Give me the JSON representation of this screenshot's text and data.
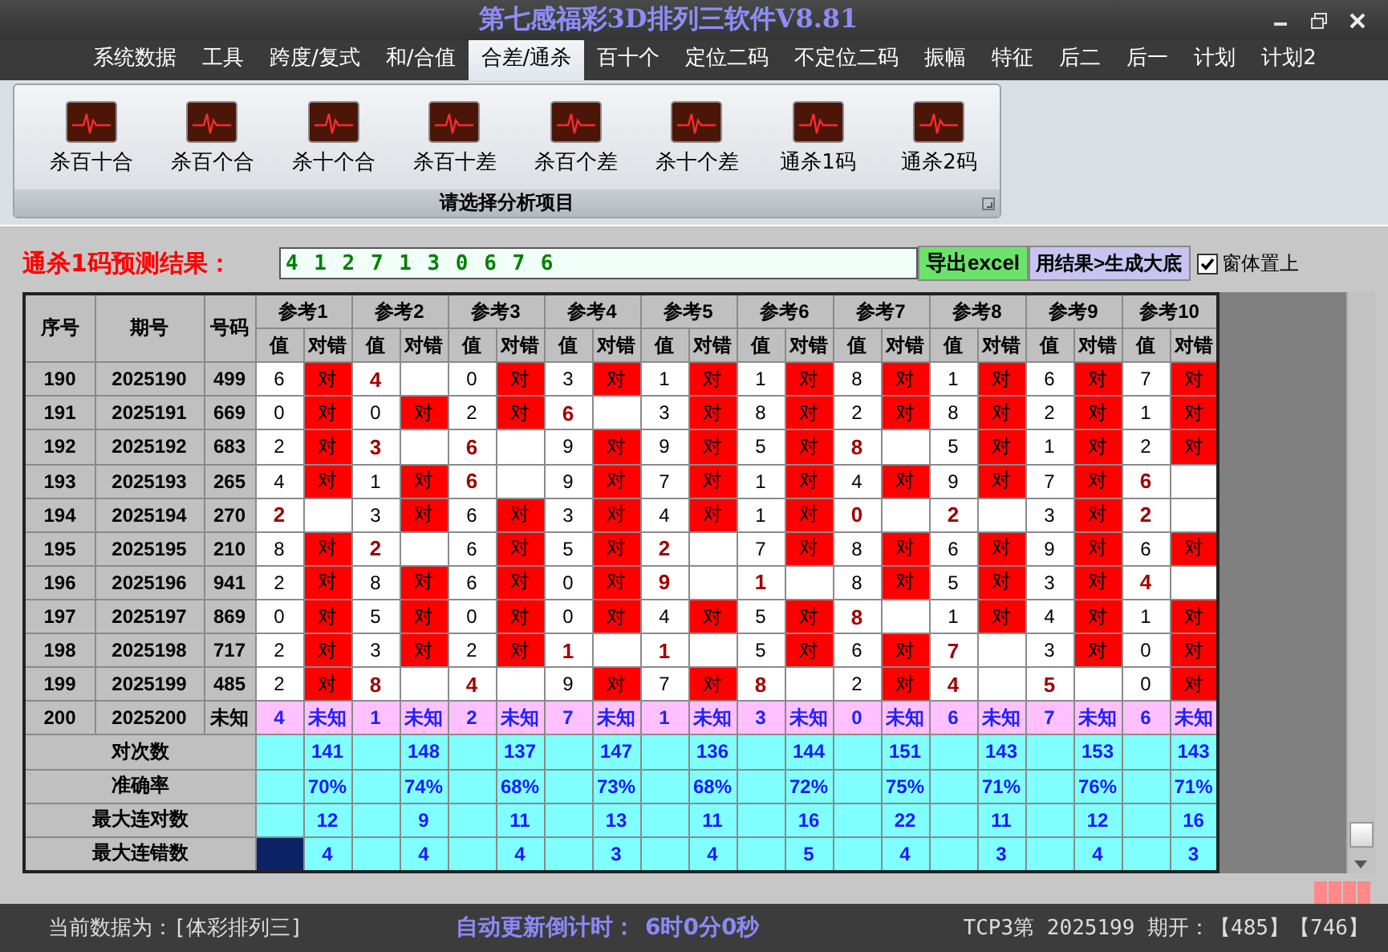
{
  "window": {
    "title": "第七感福彩3D排列三软件V8.81"
  },
  "menu": [
    {
      "label": "系统数据",
      "selected": false
    },
    {
      "label": "工具",
      "selected": false
    },
    {
      "label": "跨度/复式",
      "selected": false
    },
    {
      "label": "和/合值",
      "selected": false
    },
    {
      "label": "合差/通杀",
      "selected": true
    },
    {
      "label": "百十个",
      "selected": false
    },
    {
      "label": "定位二码",
      "selected": false
    },
    {
      "label": "不定位二码",
      "selected": false
    },
    {
      "label": "振幅",
      "selected": false
    },
    {
      "label": "特征",
      "selected": false
    },
    {
      "label": "后二",
      "selected": false
    },
    {
      "label": "后一",
      "selected": false
    },
    {
      "label": "计划",
      "selected": false
    },
    {
      "label": "计划2",
      "selected": false
    }
  ],
  "ribbon": {
    "items": [
      "杀百十合",
      "杀百个合",
      "杀十个合",
      "杀百十差",
      "杀百个差",
      "杀十个差",
      "通杀1码",
      "通杀2码"
    ],
    "group_label": "请选择分析项目"
  },
  "prediction": {
    "label": "通杀1码预测结果：",
    "value": "4 1 2 7 1 3 0 6 7 6",
    "buttons": [
      {
        "label": "导出excel",
        "kind": "export"
      },
      {
        "label": "用结果>生成大底",
        "kind": "generate"
      }
    ],
    "topmost": {
      "label": "窗体置上",
      "checked": true
    }
  },
  "table": {
    "columns": [
      "序号",
      "期号",
      "号码"
    ],
    "groups": [
      {
        "label": "参考1",
        "sub": [
          "值",
          "对错"
        ]
      },
      {
        "label": "参考2",
        "sub": [
          "值",
          "对错"
        ]
      },
      {
        "label": "参考3",
        "sub": [
          "值",
          "对错"
        ]
      },
      {
        "label": "参考4",
        "sub": [
          "值",
          "对错"
        ]
      },
      {
        "label": "参考5",
        "sub": [
          "值",
          "对错"
        ]
      },
      {
        "label": "参考6",
        "sub": [
          "值",
          "对错"
        ]
      },
      {
        "label": "参考7",
        "sub": [
          "值",
          "对错"
        ]
      },
      {
        "label": "参考8",
        "sub": [
          "值",
          "对错"
        ]
      },
      {
        "label": "参考9",
        "sub": [
          "值",
          "对错"
        ]
      },
      {
        "label": "参考10",
        "sub": [
          "值",
          "对错"
        ]
      }
    ],
    "rows": [
      {
        "kind": "history",
        "seq": "190",
        "issue": "2025190",
        "number": "499",
        "refs": [
          {
            "value": "6",
            "hit": true,
            "result": "对"
          },
          {
            "value": "4",
            "hit": false
          },
          {
            "value": "0",
            "hit": true,
            "result": "对"
          },
          {
            "value": "3",
            "hit": true,
            "result": "对"
          },
          {
            "value": "1",
            "hit": true,
            "result": "对"
          },
          {
            "value": "1",
            "hit": true,
            "result": "对"
          },
          {
            "value": "8",
            "hit": true,
            "result": "对"
          },
          {
            "value": "1",
            "hit": true,
            "result": "对"
          },
          {
            "value": "6",
            "hit": true,
            "result": "对"
          },
          {
            "value": "7",
            "hit": true,
            "result": "对"
          }
        ]
      },
      {
        "kind": "history",
        "seq": "191",
        "issue": "2025191",
        "number": "669",
        "refs": [
          {
            "value": "0",
            "hit": true,
            "result": "对"
          },
          {
            "value": "0",
            "hit": true,
            "result": "对"
          },
          {
            "value": "2",
            "hit": true,
            "result": "对"
          },
          {
            "value": "6",
            "hit": false
          },
          {
            "value": "3",
            "hit": true,
            "result": "对"
          },
          {
            "value": "8",
            "hit": true,
            "result": "对"
          },
          {
            "value": "2",
            "hit": true,
            "result": "对"
          },
          {
            "value": "8",
            "hit": true,
            "result": "对"
          },
          {
            "value": "2",
            "hit": true,
            "result": "对"
          },
          {
            "value": "1",
            "hit": true,
            "result": "对"
          }
        ]
      },
      {
        "kind": "history",
        "seq": "192",
        "issue": "2025192",
        "number": "683",
        "refs": [
          {
            "value": "2",
            "hit": true,
            "result": "对"
          },
          {
            "value": "3",
            "hit": false
          },
          {
            "value": "6",
            "hit": false
          },
          {
            "value": "9",
            "hit": true,
            "result": "对"
          },
          {
            "value": "9",
            "hit": true,
            "result": "对"
          },
          {
            "value": "5",
            "hit": true,
            "result": "对"
          },
          {
            "value": "8",
            "hit": false
          },
          {
            "value": "5",
            "hit": true,
            "result": "对"
          },
          {
            "value": "1",
            "hit": true,
            "result": "对"
          },
          {
            "value": "2",
            "hit": true,
            "result": "对"
          }
        ]
      },
      {
        "kind": "history",
        "seq": "193",
        "issue": "2025193",
        "number": "265",
        "refs": [
          {
            "value": "4",
            "hit": true,
            "result": "对"
          },
          {
            "value": "1",
            "hit": true,
            "result": "对"
          },
          {
            "value": "6",
            "hit": false
          },
          {
            "value": "9",
            "hit": true,
            "result": "对"
          },
          {
            "value": "7",
            "hit": true,
            "result": "对"
          },
          {
            "value": "1",
            "hit": true,
            "result": "对"
          },
          {
            "value": "4",
            "hit": true,
            "result": "对"
          },
          {
            "value": "9",
            "hit": true,
            "result": "对"
          },
          {
            "value": "7",
            "hit": true,
            "result": "对"
          },
          {
            "value": "6",
            "hit": false
          }
        ]
      },
      {
        "kind": "history",
        "seq": "194",
        "issue": "2025194",
        "number": "270",
        "refs": [
          {
            "value": "2",
            "hit": false
          },
          {
            "value": "3",
            "hit": true,
            "result": "对"
          },
          {
            "value": "6",
            "hit": true,
            "result": "对"
          },
          {
            "value": "3",
            "hit": true,
            "result": "对"
          },
          {
            "value": "4",
            "hit": true,
            "result": "对"
          },
          {
            "value": "1",
            "hit": true,
            "result": "对"
          },
          {
            "value": "0",
            "hit": false
          },
          {
            "value": "2",
            "hit": false
          },
          {
            "value": "3",
            "hit": true,
            "result": "对"
          },
          {
            "value": "2",
            "hit": false
          }
        ]
      },
      {
        "kind": "history",
        "seq": "195",
        "issue": "2025195",
        "number": "210",
        "refs": [
          {
            "value": "8",
            "hit": true,
            "result": "对"
          },
          {
            "value": "2",
            "hit": false
          },
          {
            "value": "6",
            "hit": true,
            "result": "对"
          },
          {
            "value": "5",
            "hit": true,
            "result": "对"
          },
          {
            "value": "2",
            "hit": false
          },
          {
            "value": "7",
            "hit": true,
            "result": "对"
          },
          {
            "value": "8",
            "hit": true,
            "result": "对"
          },
          {
            "value": "6",
            "hit": true,
            "result": "对"
          },
          {
            "value": "9",
            "hit": true,
            "result": "对"
          },
          {
            "value": "6",
            "hit": true,
            "result": "对"
          }
        ]
      },
      {
        "kind": "history",
        "seq": "196",
        "issue": "2025196",
        "number": "941",
        "refs": [
          {
            "value": "2",
            "hit": true,
            "result": "对"
          },
          {
            "value": "8",
            "hit": true,
            "result": "对"
          },
          {
            "value": "6",
            "hit": true,
            "result": "对"
          },
          {
            "value": "0",
            "hit": true,
            "result": "对"
          },
          {
            "value": "9",
            "hit": false
          },
          {
            "value": "1",
            "hit": false
          },
          {
            "value": "8",
            "hit": true,
            "result": "对"
          },
          {
            "value": "5",
            "hit": true,
            "result": "对"
          },
          {
            "value": "3",
            "hit": true,
            "result": "对"
          },
          {
            "value": "4",
            "hit": false
          }
        ]
      },
      {
        "kind": "history",
        "seq": "197",
        "issue": "2025197",
        "number": "869",
        "refs": [
          {
            "value": "0",
            "hit": true,
            "result": "对"
          },
          {
            "value": "5",
            "hit": true,
            "result": "对"
          },
          {
            "value": "0",
            "hit": true,
            "result": "对"
          },
          {
            "value": "0",
            "hit": true,
            "result": "对"
          },
          {
            "value": "4",
            "hit": true,
            "result": "对"
          },
          {
            "value": "5",
            "hit": true,
            "result": "对"
          },
          {
            "value": "8",
            "hit": false
          },
          {
            "value": "1",
            "hit": true,
            "result": "对"
          },
          {
            "value": "4",
            "hit": true,
            "result": "对"
          },
          {
            "value": "1",
            "hit": true,
            "result": "对"
          }
        ]
      },
      {
        "kind": "history",
        "seq": "198",
        "issue": "2025198",
        "number": "717",
        "refs": [
          {
            "value": "2",
            "hit": true,
            "result": "对"
          },
          {
            "value": "3",
            "hit": true,
            "result": "对"
          },
          {
            "value": "2",
            "hit": true,
            "result": "对"
          },
          {
            "value": "1",
            "hit": false
          },
          {
            "value": "1",
            "hit": false
          },
          {
            "value": "5",
            "hit": true,
            "result": "对"
          },
          {
            "value": "6",
            "hit": true,
            "result": "对"
          },
          {
            "value": "7",
            "hit": false
          },
          {
            "value": "3",
            "hit": true,
            "result": "对"
          },
          {
            "value": "0",
            "hit": true,
            "result": "对"
          }
        ]
      },
      {
        "kind": "history",
        "seq": "199",
        "issue": "2025199",
        "number": "485",
        "refs": [
          {
            "value": "2",
            "hit": true,
            "result": "对"
          },
          {
            "value": "8",
            "hit": false
          },
          {
            "value": "4",
            "hit": false
          },
          {
            "value": "9",
            "hit": true,
            "result": "对"
          },
          {
            "value": "7",
            "hit": true,
            "result": "对"
          },
          {
            "value": "8",
            "hit": false
          },
          {
            "value": "2",
            "hit": true,
            "result": "对"
          },
          {
            "value": "4",
            "hit": false
          },
          {
            "value": "5",
            "hit": false
          },
          {
            "value": "0",
            "hit": true,
            "result": "对"
          }
        ]
      },
      {
        "kind": "pending",
        "seq": "200",
        "issue": "2025200",
        "number": "未知",
        "refs": [
          {
            "value": "4",
            "result": "未知"
          },
          {
            "value": "1",
            "result": "未知"
          },
          {
            "value": "2",
            "result": "未知"
          },
          {
            "value": "7",
            "result": "未知"
          },
          {
            "value": "1",
            "result": "未知"
          },
          {
            "value": "3",
            "result": "未知"
          },
          {
            "value": "0",
            "result": "未知"
          },
          {
            "value": "6",
            "result": "未知"
          },
          {
            "value": "7",
            "result": "未知"
          },
          {
            "value": "6",
            "result": "未知"
          }
        ]
      }
    ],
    "stats": [
      {
        "label": "对次数",
        "cells": [
          {
            "value": "141",
            "selected": false
          },
          {
            "value": "148",
            "selected": false
          },
          {
            "value": "137",
            "selected": false
          },
          {
            "value": "147",
            "selected": false
          },
          {
            "value": "136",
            "selected": false
          },
          {
            "value": "144",
            "selected": false
          },
          {
            "value": "151",
            "selected": false
          },
          {
            "value": "143",
            "selected": false
          },
          {
            "value": "153",
            "selected": false
          },
          {
            "value": "143",
            "selected": false
          }
        ]
      },
      {
        "label": "准确率",
        "cells": [
          {
            "value": "70%",
            "selected": false
          },
          {
            "value": "74%",
            "selected": false
          },
          {
            "value": "68%",
            "selected": false
          },
          {
            "value": "73%",
            "selected": false
          },
          {
            "value": "68%",
            "selected": false
          },
          {
            "value": "72%",
            "selected": false
          },
          {
            "value": "75%",
            "selected": false
          },
          {
            "value": "71%",
            "selected": false
          },
          {
            "value": "76%",
            "selected": false
          },
          {
            "value": "71%",
            "selected": false
          }
        ]
      },
      {
        "label": "最大连对数",
        "cells": [
          {
            "value": "12",
            "selected": false
          },
          {
            "value": "9",
            "selected": false
          },
          {
            "value": "11",
            "selected": false
          },
          {
            "value": "13",
            "selected": false
          },
          {
            "value": "11",
            "selected": false
          },
          {
            "value": "16",
            "selected": false
          },
          {
            "value": "22",
            "selected": false
          },
          {
            "value": "11",
            "selected": false
          },
          {
            "value": "12",
            "selected": false
          },
          {
            "value": "16",
            "selected": false
          }
        ]
      },
      {
        "label": "最大连错数",
        "cells": [
          {
            "value": "4",
            "selected": true
          },
          {
            "value": "4",
            "selected": false
          },
          {
            "value": "4",
            "selected": false
          },
          {
            "value": "3",
            "selected": false
          },
          {
            "value": "4",
            "selected": false
          },
          {
            "value": "5",
            "selected": false
          },
          {
            "value": "4",
            "selected": false
          },
          {
            "value": "3",
            "selected": false
          },
          {
            "value": "4",
            "selected": false
          },
          {
            "value": "3",
            "selected": false
          }
        ]
      }
    ]
  },
  "status_bar": {
    "data_source": "当前数据为：[体彩排列三]",
    "countdown_label": "自动更新倒计时：",
    "countdown": "6时0分0秒",
    "latest": "TCP3第 2025199 期开：【485】【746】"
  }
}
